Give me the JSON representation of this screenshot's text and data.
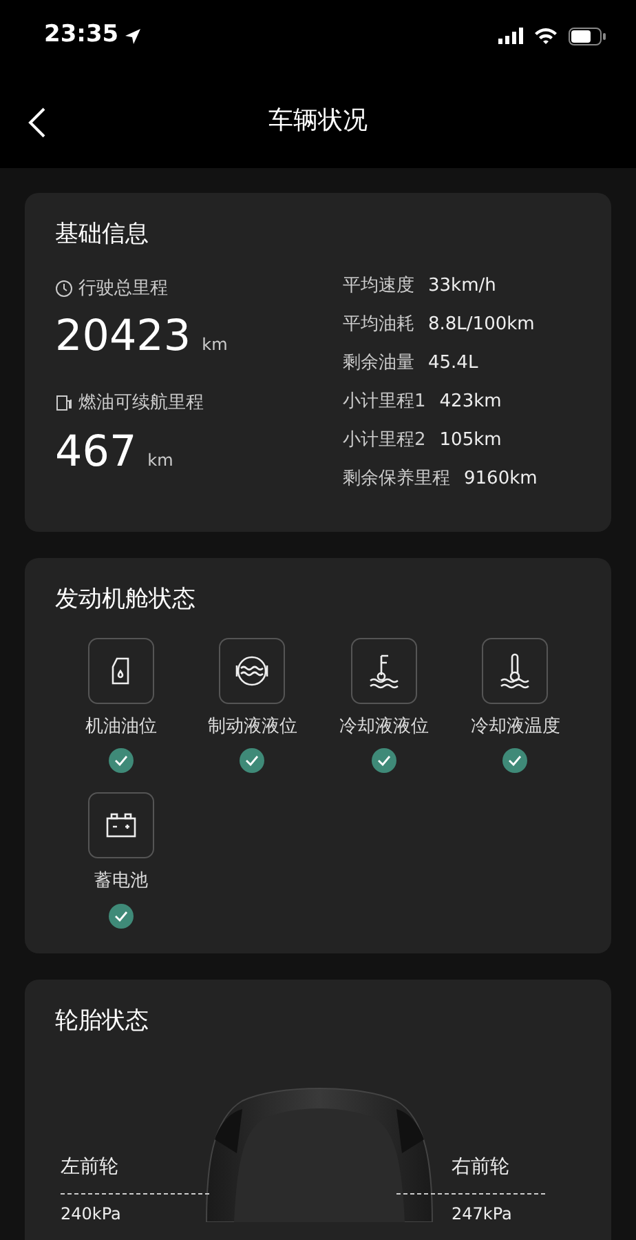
{
  "status_bar": {
    "time": "23:35"
  },
  "nav": {
    "title": "车辆状况"
  },
  "basic_info": {
    "title": "基础信息",
    "main_stats": [
      {
        "kind": "odometer",
        "label": "行驶总里程",
        "value": "20423",
        "unit": "km"
      },
      {
        "kind": "fuel",
        "label": "燃油可续航里程",
        "value": "467",
        "unit": "km"
      }
    ],
    "details": [
      {
        "label": "平均速度",
        "value": "33km/h"
      },
      {
        "label": "平均油耗",
        "value": "8.8L/100km"
      },
      {
        "label": "剩余油量",
        "value": "45.4L"
      },
      {
        "label": "小计里程1",
        "value": "423km"
      },
      {
        "label": "小计里程2",
        "value": "105km"
      },
      {
        "label": "剩余保养里程",
        "value": "9160km"
      }
    ]
  },
  "engine_status": {
    "title": "发动机舱状态",
    "items": [
      {
        "kind": "oil",
        "label": "机油油位",
        "ok": true
      },
      {
        "kind": "brake",
        "label": "制动液液位",
        "ok": true
      },
      {
        "kind": "coolant_level",
        "label": "冷却液液位",
        "ok": true
      },
      {
        "kind": "coolant_temp",
        "label": "冷却液温度",
        "ok": true
      },
      {
        "kind": "battery",
        "label": "蓄电池",
        "ok": true
      }
    ]
  },
  "tire_status": {
    "title": "轮胎状态",
    "tires": [
      {
        "label": "左前轮",
        "pressure": "240kPa"
      },
      {
        "label": "右前轮",
        "pressure": "247kPa"
      }
    ]
  }
}
